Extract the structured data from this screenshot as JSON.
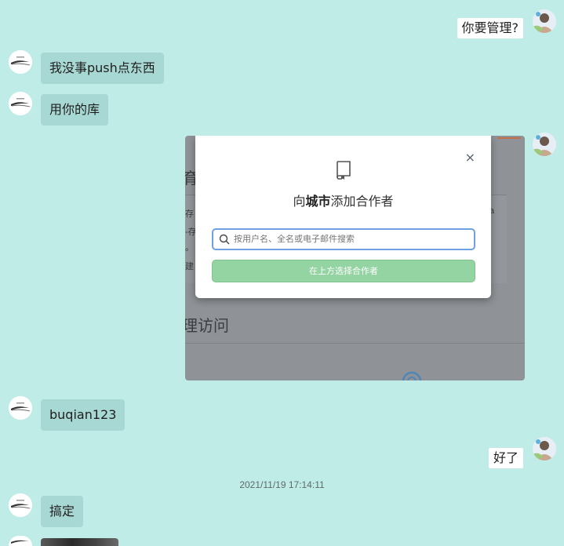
{
  "messages": [
    {
      "side": "right",
      "text": "你要管理?"
    },
    {
      "side": "left",
      "text": "我没事push点东西"
    },
    {
      "side": "left",
      "text": "用你的库"
    },
    {
      "side": "left",
      "text": "buqian123"
    },
    {
      "side": "right",
      "text": "好了"
    },
    {
      "side": "left",
      "text": "搞定"
    }
  ],
  "timestamp": "2021/11/19 17:14:11",
  "shared_image": {
    "modal_title_prefix": "向",
    "modal_title_repo": "城市",
    "modal_title_suffix": "添加合作者",
    "search_placeholder": "按用户名、全名或电子邮件搜索",
    "select_button": "在上方选择合作者",
    "close": "×",
    "bg_heading_1": "育",
    "bg_heading_2": "理访问",
    "bg_left_1": "存",
    "bg_left_2": "-存",
    "bg_left_3": "。",
    "bg_left_4": "建",
    "bg_right_1": "a"
  },
  "colors": {
    "background": "#bfece6",
    "bubble_left": "#a8d8d3",
    "bubble_right": "#ffffff",
    "button": "#94d3a2"
  }
}
